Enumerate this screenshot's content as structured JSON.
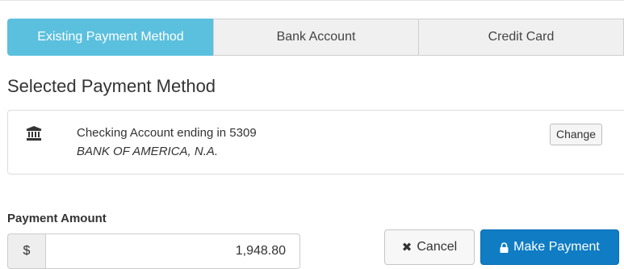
{
  "tabs": [
    {
      "label": "Existing Payment Method",
      "active": true
    },
    {
      "label": "Bank Account",
      "active": false
    },
    {
      "label": "Credit Card",
      "active": false
    }
  ],
  "selected_method": {
    "title": "Selected Payment Method",
    "icon": "bank-icon",
    "account_line": "Checking Account ending in 5309",
    "bank_name": "BANK OF AMERICA, N.A.",
    "change_label": "Change"
  },
  "payment": {
    "amount_label": "Payment Amount",
    "currency_symbol": "$",
    "amount_value": "1,948.80"
  },
  "actions": {
    "cancel_label": "Cancel",
    "cancel_icon": "close-icon",
    "pay_label": "Make Payment",
    "pay_icon": "lock-icon"
  },
  "colors": {
    "active_tab": "#5bc0de",
    "primary_button": "#0f7cc4"
  }
}
